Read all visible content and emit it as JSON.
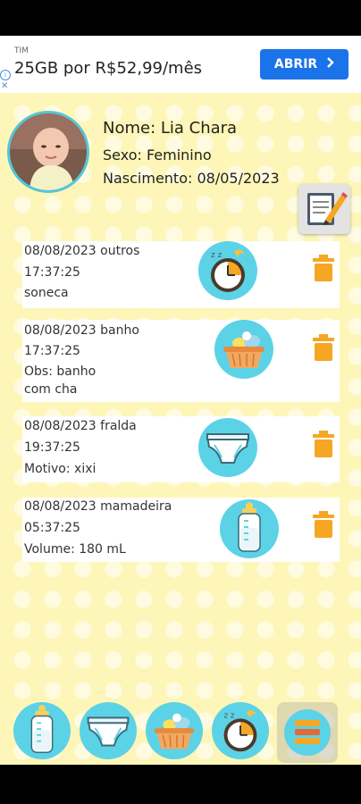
{
  "ad": {
    "brand": "TIM",
    "title": "25GB por R$52,99/mês",
    "button": "ABRIR",
    "info_symbol": "i",
    "close_symbol": "✕"
  },
  "profile": {
    "name": "Nome: Lia Chara",
    "sex": "Sexo: Feminino",
    "birth": "Nascimento: 08/05/2023"
  },
  "entries": [
    {
      "line1": "08/08/2023 outros",
      "line2": "17:37:25",
      "line3": "soneca",
      "line4": "",
      "icon": "sleep-clock-icon"
    },
    {
      "line1": "08/08/2023 banho",
      "line2": "17:37:25",
      "line3": "Obs: banho",
      "line4": "com cha",
      "icon": "bath-tub-icon"
    },
    {
      "line1": "08/08/2023 fralda",
      "line2": "19:37:25",
      "line3": "Motivo: xixi",
      "line4": "",
      "icon": "diaper-icon"
    },
    {
      "line1": "08/08/2023 mamadeira",
      "line2": "05:37:25",
      "line3": "Volume: 180 mL",
      "line4": "",
      "icon": "baby-bottle-icon"
    }
  ],
  "bottom_bar": [
    "baby-bottle-icon",
    "diaper-icon",
    "bath-tub-icon",
    "sleep-clock-icon",
    "menu-icon"
  ],
  "colors": {
    "background": "#fdf6b8",
    "icon_circle": "#5cd2e6",
    "trash": "#f5a623",
    "ad_button": "#1a73e8"
  }
}
